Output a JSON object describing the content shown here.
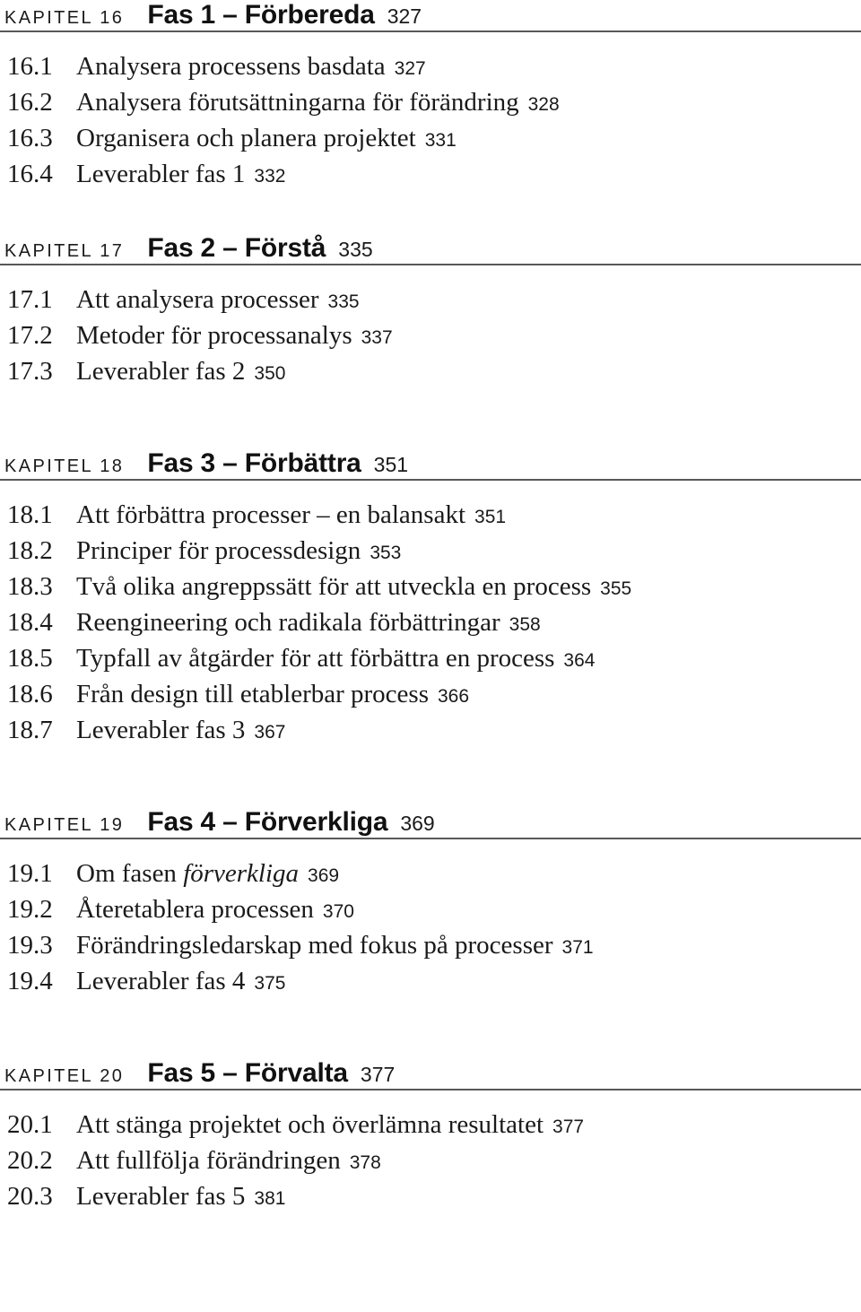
{
  "document": {
    "type": "table-of-contents",
    "language": "sv"
  },
  "chapters": [
    {
      "kapitel_label": "KAPITEL 16",
      "title": "Fas 1 – Förbereda",
      "page": "327",
      "entries": [
        {
          "number": "16.1",
          "title": "Analysera processens basdata",
          "page": "327"
        },
        {
          "number": "16.2",
          "title": "Analysera förutsättningarna för förändring",
          "page": "328"
        },
        {
          "number": "16.3",
          "title": "Organisera och planera projektet",
          "page": "331"
        },
        {
          "number": "16.4",
          "title": "Leverabler fas 1",
          "page": "332"
        }
      ]
    },
    {
      "kapitel_label": "KAPITEL 17",
      "title": "Fas 2 – Förstå",
      "page": "335",
      "entries": [
        {
          "number": "17.1",
          "title": "Att analysera processer",
          "page": "335"
        },
        {
          "number": "17.2",
          "title": "Metoder för processanalys",
          "page": "337"
        },
        {
          "number": "17.3",
          "title": "Leverabler fas 2",
          "page": "350"
        }
      ]
    },
    {
      "kapitel_label": "KAPITEL 18",
      "title": "Fas 3 – Förbättra",
      "page": "351",
      "entries": [
        {
          "number": "18.1",
          "title": "Att förbättra processer – en balansakt",
          "page": "351"
        },
        {
          "number": "18.2",
          "title": "Principer för processdesign",
          "page": "353"
        },
        {
          "number": "18.3",
          "title": "Två olika angreppssätt för att utveckla en process",
          "page": "355"
        },
        {
          "number": "18.4",
          "title": "Reengineering och radikala förbättringar",
          "page": "358"
        },
        {
          "number": "18.5",
          "title": "Typfall av åtgärder för att förbättra en process",
          "page": "364"
        },
        {
          "number": "18.6",
          "title": "Från design till etablerbar process",
          "page": "366"
        },
        {
          "number": "18.7",
          "title": "Leverabler fas 3",
          "page": "367"
        }
      ]
    },
    {
      "kapitel_label": "KAPITEL 19",
      "title": "Fas 4 – Förverkliga",
      "page": "369",
      "entries": [
        {
          "number": "19.1",
          "title_pre": "Om fasen ",
          "title_italic": "förverkliga",
          "title_post": "",
          "page": "369"
        },
        {
          "number": "19.2",
          "title": "Återetablera processen",
          "page": "370"
        },
        {
          "number": "19.3",
          "title": "Förändringsledarskap med fokus på processer",
          "page": "371"
        },
        {
          "number": "19.4",
          "title": "Leverabler fas 4",
          "page": "375"
        }
      ]
    },
    {
      "kapitel_label": "KAPITEL 20",
      "title": "Fas 5 – Förvalta",
      "page": "377",
      "entries": [
        {
          "number": "20.1",
          "title": "Att stänga projektet och överlämna resultatet",
          "page": "377"
        },
        {
          "number": "20.2",
          "title": "Att fullfölja förändringen",
          "page": "378"
        },
        {
          "number": "20.3",
          "title": "Leverabler fas 5",
          "page": "381"
        }
      ]
    }
  ],
  "colors": {
    "text": "#1a1a1a",
    "rule": "#58585a",
    "background": "#ffffff"
  }
}
